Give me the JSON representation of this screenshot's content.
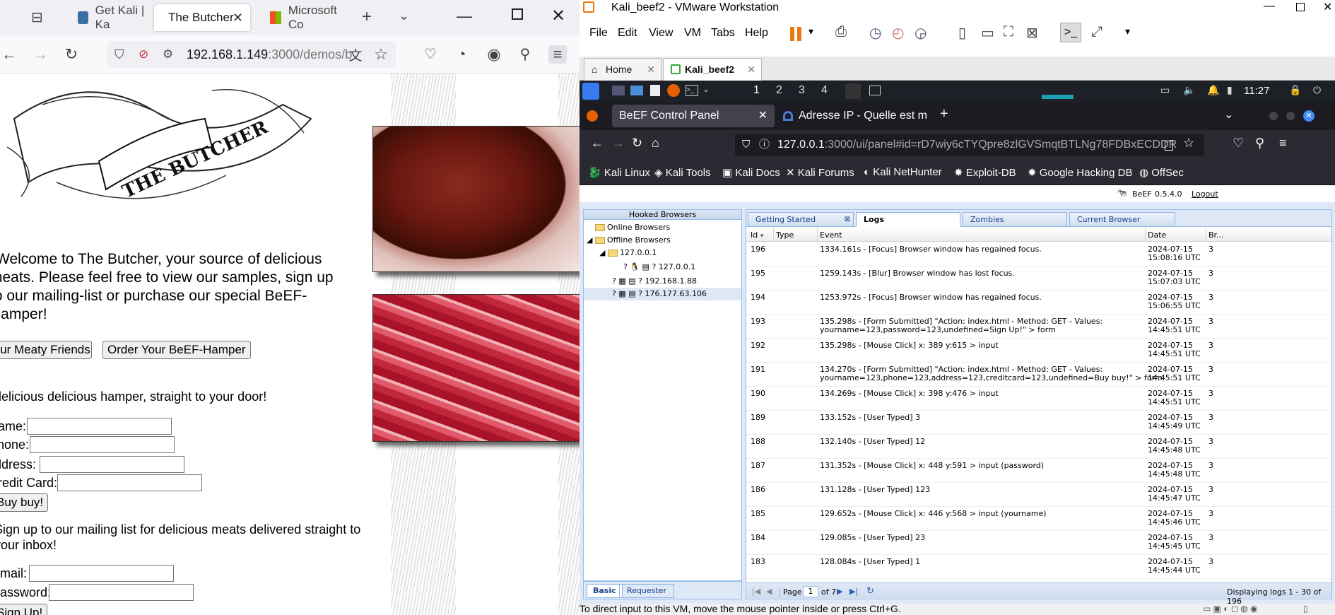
{
  "left_browser": {
    "tabs": [
      {
        "label": "Get Kali | Ka"
      },
      {
        "label": "The Butcher"
      },
      {
        "label": "Microsoft Co"
      }
    ],
    "url_host": "192.168.1.149",
    "url_rest": ":3000/demos/b",
    "page": {
      "logo_text": "THE BUTCHER",
      "welcome_line1": "Welcome to The Butcher, your source of delicious",
      "welcome_line2": "meats. Please feel free to view our samples, sign up",
      "welcome_line3": "to our mailing-list or purchase our special BeEF-",
      "welcome_line4": "Hamper!",
      "btn_friends": "Our Meaty Friends",
      "btn_hamper": "Order Your BeEF-Hamper",
      "hamper_text": "delicious delicious hamper, straight to your door!",
      "label_name": "Name:",
      "label_phone": "Phone:",
      "label_address": "Address:",
      "label_card": "Credit Card:",
      "btn_buy": "Buy buy!",
      "signup_line1": "Sign up to our mailing list for delicious meats delivered straight to",
      "signup_line2": "your inbox!",
      "label_email": "Email:",
      "label_password": "Password:",
      "btn_signup": "Sign Up!"
    }
  },
  "vmware": {
    "title": "Kali_beef2 - VMware Workstation",
    "menu": [
      "File",
      "Edit",
      "View",
      "VM",
      "Tabs",
      "Help"
    ],
    "tabs": [
      {
        "label": "Home"
      },
      {
        "label": "Kali_beef2"
      }
    ],
    "status_text": "To direct input to this VM, move the mouse pointer inside or press Ctrl+G.",
    "kali_bar": {
      "workspaces": [
        "1",
        "2",
        "3",
        "4"
      ],
      "clock": "11:27"
    },
    "firefox": {
      "tabs": [
        {
          "label": "BeEF Control Panel"
        },
        {
          "label": "Adresse IP - Quelle est m"
        }
      ],
      "url_host": "127.0.0.1",
      "url_rest": ":3000/ui/panel#id=rD7wiy6cTYQpre8zlGVSmqtBTLNg78FDBxECDDR",
      "bookmarks": [
        "Kali Linux",
        "Kali Tools",
        "Kali Docs",
        "Kali Forums",
        "Kali NetHunter",
        "Exploit-DB",
        "Google Hacking DB",
        "OffSec"
      ]
    },
    "beef": {
      "brand": "BeEF",
      "version": "0.5.4.0",
      "logout": "Logout",
      "hooked_title": "Hooked Browsers",
      "tree": {
        "online": "Online Browsers",
        "offline": "Offline Browsers",
        "group": "127.0.0.1",
        "hosts": [
          "127.0.0.1",
          "192.168.1.88",
          "176.177.63.106"
        ]
      },
      "lower_tabs": [
        "Basic",
        "Requester"
      ],
      "panel_tabs": [
        "Getting Started",
        "Logs",
        "Zombies",
        "Current Browser"
      ],
      "columns": [
        "Id",
        "Type",
        "Event",
        "Date",
        "Br..."
      ],
      "rows": [
        {
          "id": "196",
          "event": "1334.161s - [Focus] Browser window has regained focus.",
          "event2": "",
          "date1": "2024-07-15",
          "date2": "15:08:16 UTC",
          "br": "3"
        },
        {
          "id": "195",
          "event": "1259.143s - [Blur] Browser window has lost focus.",
          "event2": "",
          "date1": "2024-07-15",
          "date2": "15:07:03 UTC",
          "br": "3"
        },
        {
          "id": "194",
          "event": "1253.972s - [Focus] Browser window has regained focus.",
          "event2": "",
          "date1": "2024-07-15",
          "date2": "15:06:55 UTC",
          "br": "3"
        },
        {
          "id": "193",
          "event": "135.298s - [Form Submitted] \"Action: index.html - Method: GET - Values:",
          "event2": "yourname=123,password=123,undefined=Sign Up!\" > form",
          "date1": "2024-07-15",
          "date2": "14:45:51 UTC",
          "br": "3"
        },
        {
          "id": "192",
          "event": "135.298s - [Mouse Click] x: 389 y:615 > input",
          "event2": "",
          "date1": "2024-07-15",
          "date2": "14:45:51 UTC",
          "br": "3"
        },
        {
          "id": "191",
          "event": "134.270s - [Form Submitted] \"Action: index.html - Method: GET - Values:",
          "event2": "yourname=123,phone=123,address=123,creditcard=123,undefined=Buy buy!\" > form",
          "date1": "2024-07-15",
          "date2": "14:45:51 UTC",
          "br": "3"
        },
        {
          "id": "190",
          "event": "134.269s - [Mouse Click] x: 398 y:476 > input",
          "event2": "",
          "date1": "2024-07-15",
          "date2": "14:45:51 UTC",
          "br": "3"
        },
        {
          "id": "189",
          "event": "133.152s - [User Typed] 3",
          "event2": "",
          "date1": "2024-07-15",
          "date2": "14:45:49 UTC",
          "br": "3"
        },
        {
          "id": "188",
          "event": "132.140s - [User Typed] 12",
          "event2": "",
          "date1": "2024-07-15",
          "date2": "14:45:48 UTC",
          "br": "3"
        },
        {
          "id": "187",
          "event": "131.352s - [Mouse Click] x: 448 y:591 > input (password)",
          "event2": "",
          "date1": "2024-07-15",
          "date2": "14:45:48 UTC",
          "br": "3"
        },
        {
          "id": "186",
          "event": "131.128s - [User Typed] 123",
          "event2": "",
          "date1": "2024-07-15",
          "date2": "14:45:47 UTC",
          "br": "3"
        },
        {
          "id": "185",
          "event": "129.652s - [Mouse Click] x: 446 y:568 > input (yourname)",
          "event2": "",
          "date1": "2024-07-15",
          "date2": "14:45:46 UTC",
          "br": "3"
        },
        {
          "id": "184",
          "event": "129.085s - [User Typed] 23",
          "event2": "",
          "date1": "2024-07-15",
          "date2": "14:45:45 UTC",
          "br": "3"
        },
        {
          "id": "183",
          "event": "128.084s - [User Typed] 1",
          "event2": "",
          "date1": "2024-07-15",
          "date2": "14:45:44 UTC",
          "br": "3"
        }
      ],
      "pager": {
        "page_label": "Page",
        "page_value": "1",
        "of_label": "of 7",
        "display": "Displaying logs 1 - 30 of 196"
      }
    }
  }
}
